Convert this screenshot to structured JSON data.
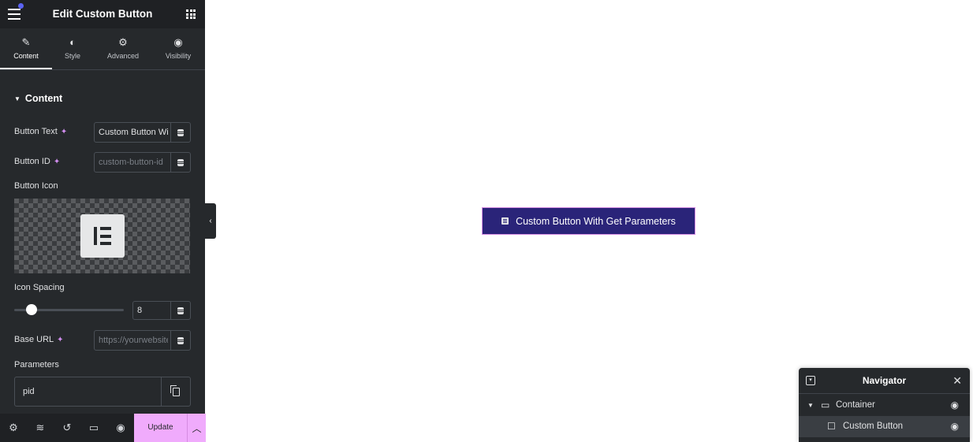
{
  "panel": {
    "title": "Edit Custom Button",
    "tabs": [
      {
        "label": "Content",
        "icon": "pencil-icon"
      },
      {
        "label": "Style",
        "icon": "contrast-icon"
      },
      {
        "label": "Advanced",
        "icon": "gear-icon"
      },
      {
        "label": "Visibility",
        "icon": "eye-icon"
      }
    ],
    "section_title": "Content",
    "fields": {
      "button_text": {
        "label": "Button Text",
        "value": "Custom Button Wi"
      },
      "button_id": {
        "label": "Button ID",
        "placeholder": "custom-button-id"
      },
      "button_icon": {
        "label": "Button Icon"
      },
      "icon_spacing": {
        "label": "Icon Spacing",
        "value": "8",
        "fill": 0.08
      },
      "base_url": {
        "label": "Base URL",
        "placeholder": "https://yourwebsite"
      },
      "parameters": {
        "label": "Parameters",
        "items": [
          "pid"
        ]
      }
    },
    "footer": {
      "update_label": "Update"
    }
  },
  "canvas": {
    "button_label": "Custom Button With Get Parameters"
  },
  "navigator": {
    "title": "Navigator",
    "items": [
      {
        "label": "Container",
        "expanded": true
      },
      {
        "label": "Custom Button",
        "selected": true
      }
    ]
  },
  "colors": {
    "accent": "#f0abfc",
    "panel": "#26292c",
    "button": "#2a2479"
  }
}
